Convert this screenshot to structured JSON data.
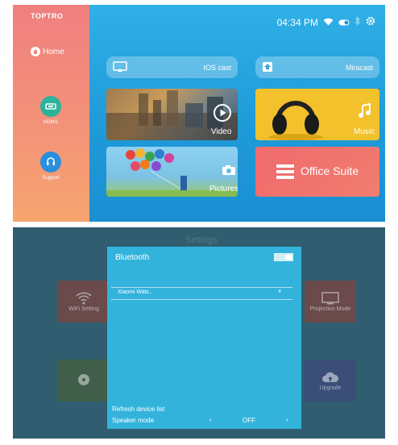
{
  "top_screen": {
    "brand": "TOPTRO",
    "home_label": "Home",
    "sidebar_items": [
      {
        "label": "HDMI1",
        "icon": "hdmi-icon",
        "color": "#2bb39c"
      },
      {
        "label": "Support",
        "icon": "headset-icon",
        "color": "#2a8fdd"
      }
    ],
    "status": {
      "time": "04:34 PM"
    },
    "tiles": {
      "ios_cast": "IOS cast",
      "miracast": "Miracast",
      "video": "Video",
      "music": "Music",
      "pictures": "Pictures",
      "office_suite": "Office Suite"
    }
  },
  "bottom_screen": {
    "background_title": "Settings",
    "background_cards": [
      "WiFi Setting",
      "Projection Mode",
      "",
      "Upgrade"
    ],
    "dialog": {
      "title": "Bluetooth",
      "toggle_on": true,
      "device": "Xiaomi Watc..",
      "device_close": "x",
      "refresh": "Refresh device list",
      "speaker_label": "Speaker mode",
      "prev": "‹",
      "speaker_value": "OFF",
      "next": "›"
    }
  }
}
